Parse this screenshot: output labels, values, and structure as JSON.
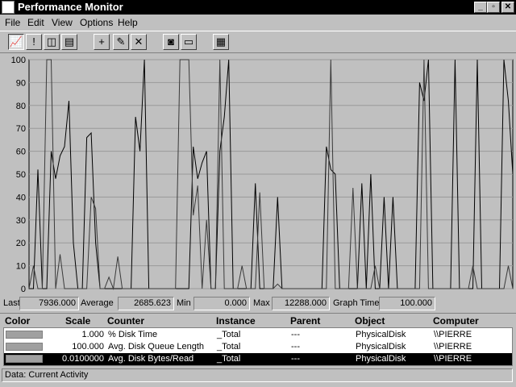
{
  "window": {
    "title": "Performance Monitor"
  },
  "menu": [
    "File",
    "Edit",
    "View",
    "Options",
    "Help"
  ],
  "toolbar": {
    "icons": [
      "chart-view-icon",
      "alert-view-icon",
      "log-view-icon",
      "report-view-icon",
      "add-counter-icon",
      "edit-counter-icon",
      "delete-counter-icon",
      "update-now-icon",
      "bookmark-icon",
      "options-icon"
    ]
  },
  "values": {
    "last_label": "Last",
    "last": "7936.000",
    "average_label": "Average",
    "average": "2685.623",
    "min_label": "Min",
    "min": "0.000",
    "max_label": "Max",
    "max": "12288.000",
    "graph_time_label": "Graph Time",
    "graph_time": "100.000"
  },
  "legend": {
    "headers": [
      "Color",
      "Scale",
      "Counter",
      "Instance",
      "Parent",
      "Object",
      "Computer"
    ],
    "rows": [
      {
        "scale": "1.000",
        "counter": "% Disk Time",
        "instance": "_Total",
        "parent": "---",
        "object": "PhysicalDisk",
        "computer": "\\\\PIERRE",
        "selected": false
      },
      {
        "scale": "100.000",
        "counter": "Avg. Disk Queue Length",
        "instance": "_Total",
        "parent": "---",
        "object": "PhysicalDisk",
        "computer": "\\\\PIERRE",
        "selected": false
      },
      {
        "scale": "0.0100000",
        "counter": "Avg. Disk Bytes/Read",
        "instance": "_Total",
        "parent": "---",
        "object": "PhysicalDisk",
        "computer": "\\\\PIERRE",
        "selected": true
      }
    ]
  },
  "status": "Data: Current Activity",
  "chart_data": {
    "type": "line",
    "ylim": [
      0,
      100
    ],
    "yticks": [
      "0",
      "10",
      "20",
      "30",
      "40",
      "50",
      "60",
      "70",
      "80",
      "90",
      "100"
    ],
    "grid": true,
    "series": [
      {
        "values": [
          0,
          0,
          52,
          0,
          0,
          60,
          48,
          58,
          62,
          82,
          20,
          0,
          0,
          66,
          68,
          20,
          0,
          0,
          0,
          0,
          0,
          0,
          0,
          0,
          75,
          60,
          100,
          0,
          0,
          0,
          0,
          0,
          0,
          0,
          0,
          0,
          0,
          62,
          48,
          55,
          60,
          0,
          0,
          60,
          75,
          100,
          0,
          0,
          0,
          0,
          0,
          46,
          0,
          0,
          0,
          0,
          40,
          0,
          0,
          0,
          0,
          0,
          0,
          0,
          0,
          0,
          0,
          62,
          52,
          50,
          0,
          0,
          0,
          0,
          0,
          46,
          0,
          50,
          0,
          0,
          40,
          0,
          40,
          0,
          0,
          0,
          0,
          0,
          90,
          82,
          100,
          0,
          0,
          0,
          0,
          0,
          100,
          0,
          0,
          0,
          0,
          100,
          0,
          0,
          0,
          0,
          0,
          100,
          82,
          50
        ]
      },
      {
        "values": [
          0,
          10,
          0,
          0,
          100,
          100,
          0,
          15,
          0,
          0,
          0,
          0,
          0,
          0,
          40,
          35,
          0,
          0,
          5,
          0,
          14,
          0,
          0,
          0,
          0,
          0,
          0,
          0,
          0,
          0,
          0,
          0,
          0,
          0,
          100,
          100,
          100,
          32,
          45,
          0,
          30,
          0,
          0,
          100,
          0,
          0,
          0,
          0,
          10,
          0,
          0,
          0,
          42,
          0,
          0,
          0,
          2,
          0,
          0,
          0,
          0,
          0,
          0,
          0,
          0,
          0,
          0,
          0,
          100,
          0,
          0,
          0,
          0,
          44,
          0,
          0,
          0,
          0,
          10,
          0,
          0,
          0,
          0,
          0,
          0,
          0,
          0,
          0,
          0,
          100,
          0,
          0,
          0,
          0,
          0,
          0,
          0,
          0,
          0,
          0,
          10,
          0,
          0,
          0,
          0,
          0,
          0,
          0,
          10,
          0
        ]
      }
    ]
  }
}
